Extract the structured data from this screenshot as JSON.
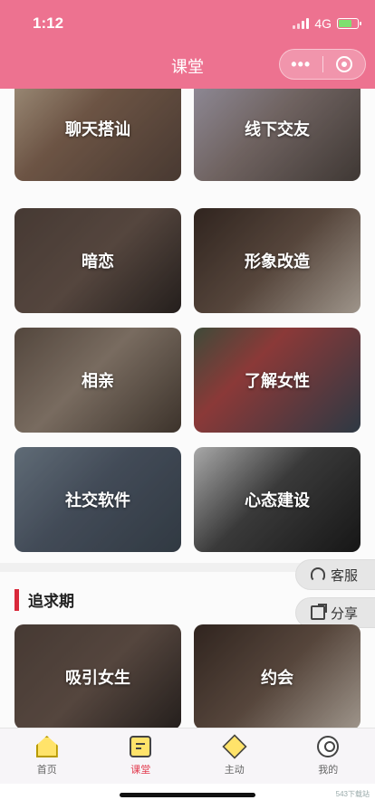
{
  "status_bar": {
    "time": "1:12",
    "network": "4G"
  },
  "nav": {
    "title": "课堂",
    "more_label": "•••"
  },
  "cards": [
    {
      "label": "聊天搭讪"
    },
    {
      "label": "线下交友"
    },
    {
      "label": "暗恋"
    },
    {
      "label": "形象改造"
    },
    {
      "label": "相亲"
    },
    {
      "label": "了解女性"
    },
    {
      "label": "社交软件"
    },
    {
      "label": "心态建设"
    },
    {
      "label": "吸引女生"
    },
    {
      "label": "约会"
    }
  ],
  "section": {
    "title": "追求期"
  },
  "floating": {
    "service": "客服",
    "share": "分享"
  },
  "tabbar": {
    "items": [
      {
        "label": "首页",
        "icon": "home-icon"
      },
      {
        "label": "课堂",
        "icon": "classroom-icon",
        "active": true
      },
      {
        "label": "主动",
        "icon": "initiative-icon"
      },
      {
        "label": "我的",
        "icon": "profile-icon"
      }
    ]
  },
  "watermark": "543下载站",
  "colors": {
    "header": "#ed7290",
    "accent": "#e23b4e",
    "section_bar": "#d9283a"
  }
}
